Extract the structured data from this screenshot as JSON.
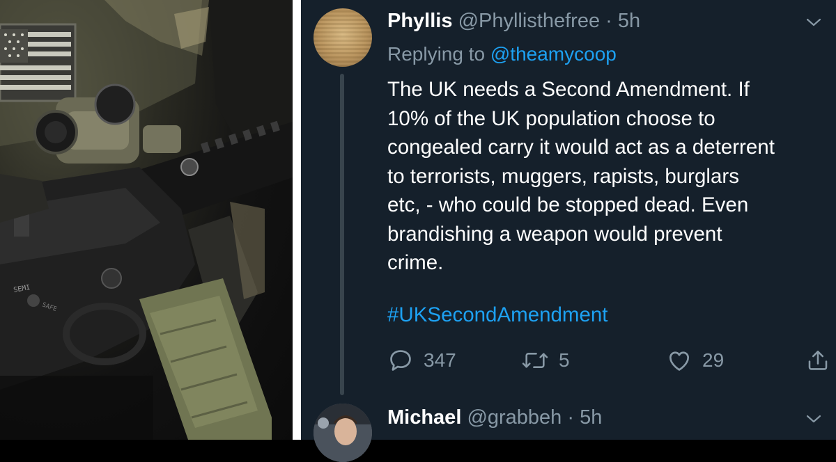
{
  "photo": {
    "stamp_semi": "SEMI",
    "stamp_safe": "SAFE"
  },
  "tweet": {
    "display_name": "Phyllis",
    "handle": "@Phyllisthefree",
    "separator": "·",
    "time": "5h",
    "replying_prefix": "Replying to",
    "replying_to": "@theamycoop",
    "body_lines": [
      "The UK needs a Second Amendment.  If",
      "10% of the UK population choose to",
      "congealed carry it would act as a deterrent",
      "to terrorists, muggers, rapists, burglars",
      "etc, - who could be stopped dead.  Even",
      "brandishing a weapon would prevent",
      "crime."
    ],
    "hashtag": "#UKSecondAmendment",
    "replies": "347",
    "retweets": "5",
    "likes": "29"
  },
  "next_tweet": {
    "display_name": "Michael",
    "handle": "@grabbeh",
    "separator": "·",
    "time": "5h"
  },
  "icons": {
    "reply": "reply-icon",
    "retweet": "retweet-icon",
    "like": "heart-icon",
    "share": "share-icon",
    "menu": "chevron-down-icon"
  },
  "colors": {
    "background": "#15202b",
    "link": "#1da1f2",
    "muted": "#8899a6"
  }
}
